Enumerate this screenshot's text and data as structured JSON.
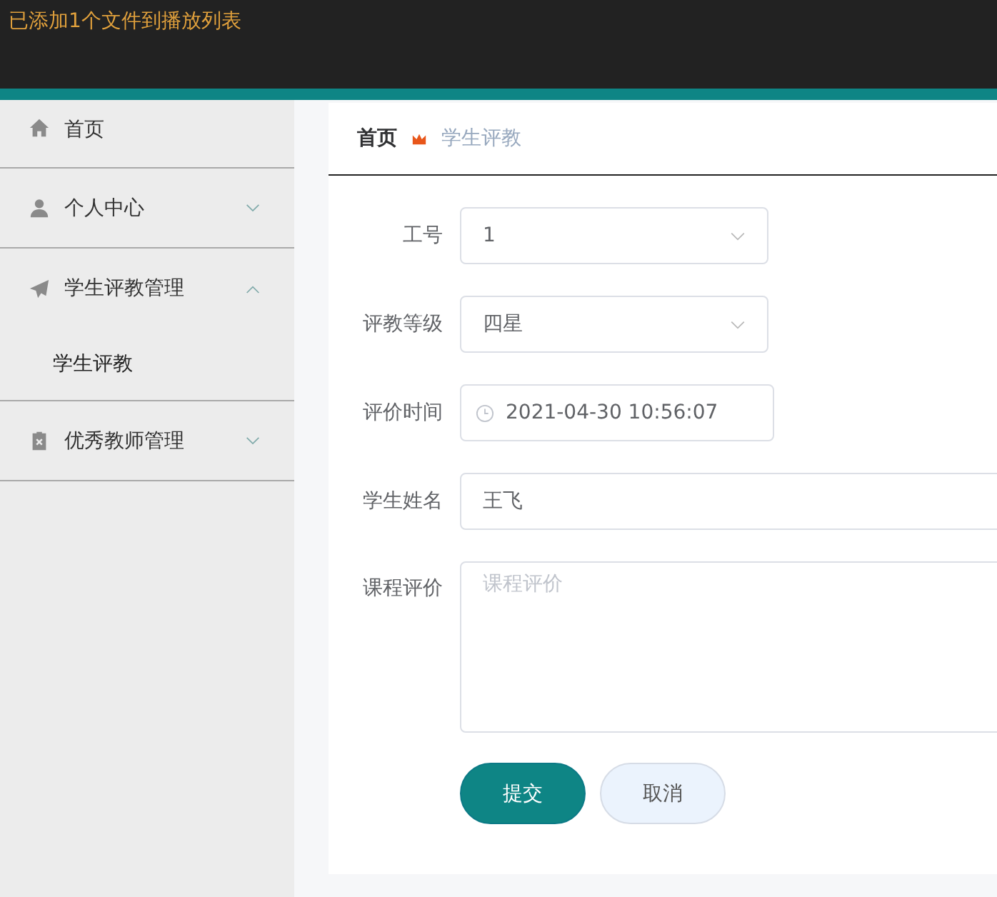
{
  "notification": {
    "text": "已添加1个文件到播放列表"
  },
  "sidebar": {
    "items": [
      {
        "label": "首页",
        "kind": "link"
      },
      {
        "label": "个人中心",
        "kind": "submenu",
        "expanded": false
      },
      {
        "label": "学生评教管理",
        "kind": "submenu",
        "expanded": true,
        "children": [
          {
            "label": "学生评教"
          }
        ]
      },
      {
        "label": "优秀教师管理",
        "kind": "submenu",
        "expanded": false
      }
    ]
  },
  "breadcrumb": [
    {
      "label": "首页"
    },
    {
      "label": "学生评教"
    }
  ],
  "form": {
    "fields": [
      {
        "label": "工号",
        "kind": "select",
        "value": "1"
      },
      {
        "label": "评教等级",
        "kind": "select",
        "value": "四星"
      },
      {
        "label": "评价时间",
        "kind": "date",
        "value": "2021-04-30 10:56:07"
      },
      {
        "label": "学生姓名",
        "kind": "text",
        "value": "王飞"
      },
      {
        "label": "课程评价",
        "kind": "textarea",
        "placeholder": "课程评价"
      }
    ],
    "buttons": [
      {
        "label": "提交",
        "kind": "primary"
      },
      {
        "label": "取消",
        "kind": "secondary"
      }
    ]
  }
}
